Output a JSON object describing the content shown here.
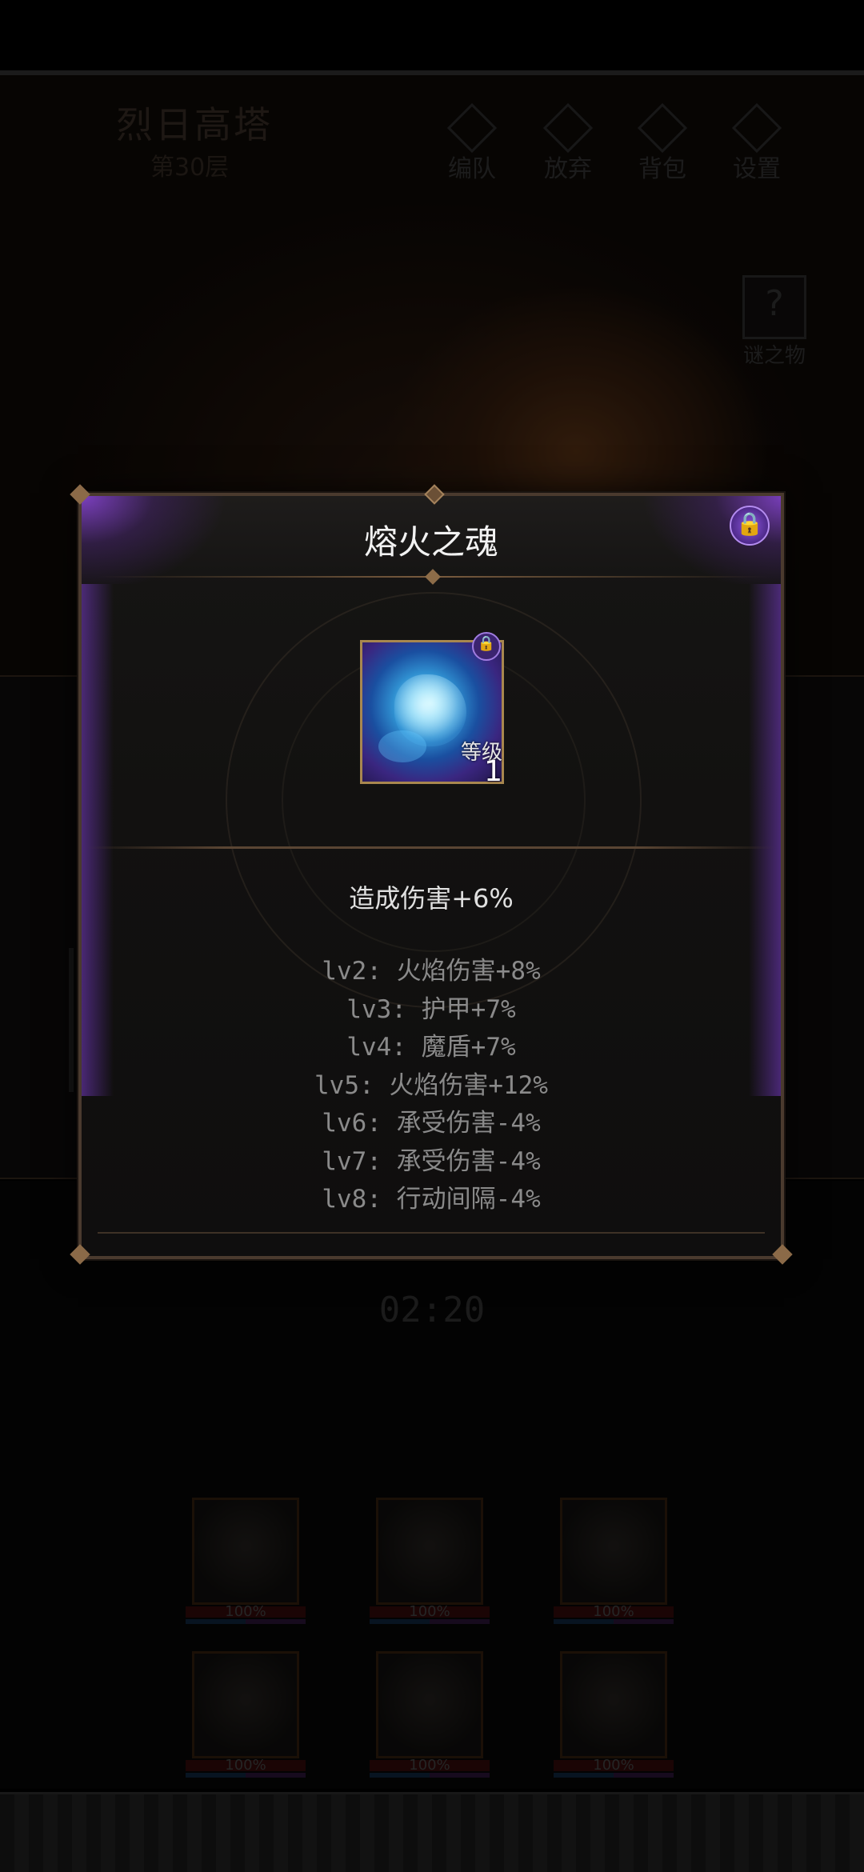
{
  "hud": {
    "tower_title": "烈日高塔",
    "tower_floor": "第30层",
    "buttons": [
      {
        "label": "编队",
        "icon": "formation-icon"
      },
      {
        "label": "放弃",
        "icon": "abandon-icon"
      },
      {
        "label": "背包",
        "icon": "backpack-icon"
      },
      {
        "label": "设置",
        "icon": "settings-icon"
      }
    ],
    "mystery_item": {
      "label": "谜之物",
      "glyph": "?"
    },
    "timer": "02:20"
  },
  "party": [
    {
      "hp": "100%"
    },
    {
      "hp": "100%"
    },
    {
      "hp": "100%"
    },
    {
      "hp": "100%"
    },
    {
      "hp": "100%"
    },
    {
      "hp": "100%"
    }
  ],
  "modal": {
    "title": "熔火之魂",
    "lock_glyph": "🔒",
    "item": {
      "level_label": "等级",
      "level_value": "1",
      "icon": "molten-soul-icon"
    },
    "current_effect": "造成伤害+6%",
    "levels": [
      "lv2: 火焰伤害+8%",
      "lv3: 护甲+7%",
      "lv4: 魔盾+7%",
      "lv5: 火焰伤害+12%",
      "lv6: 承受伤害-4%",
      "lv7: 承受伤害-4%",
      "lv8: 行动间隔-4%"
    ]
  },
  "colors": {
    "accent_purple": "#8c55dd",
    "frame_bronze": "#a8874f",
    "text_primary": "#f2f2f2",
    "text_muted": "#8a8a8a"
  }
}
